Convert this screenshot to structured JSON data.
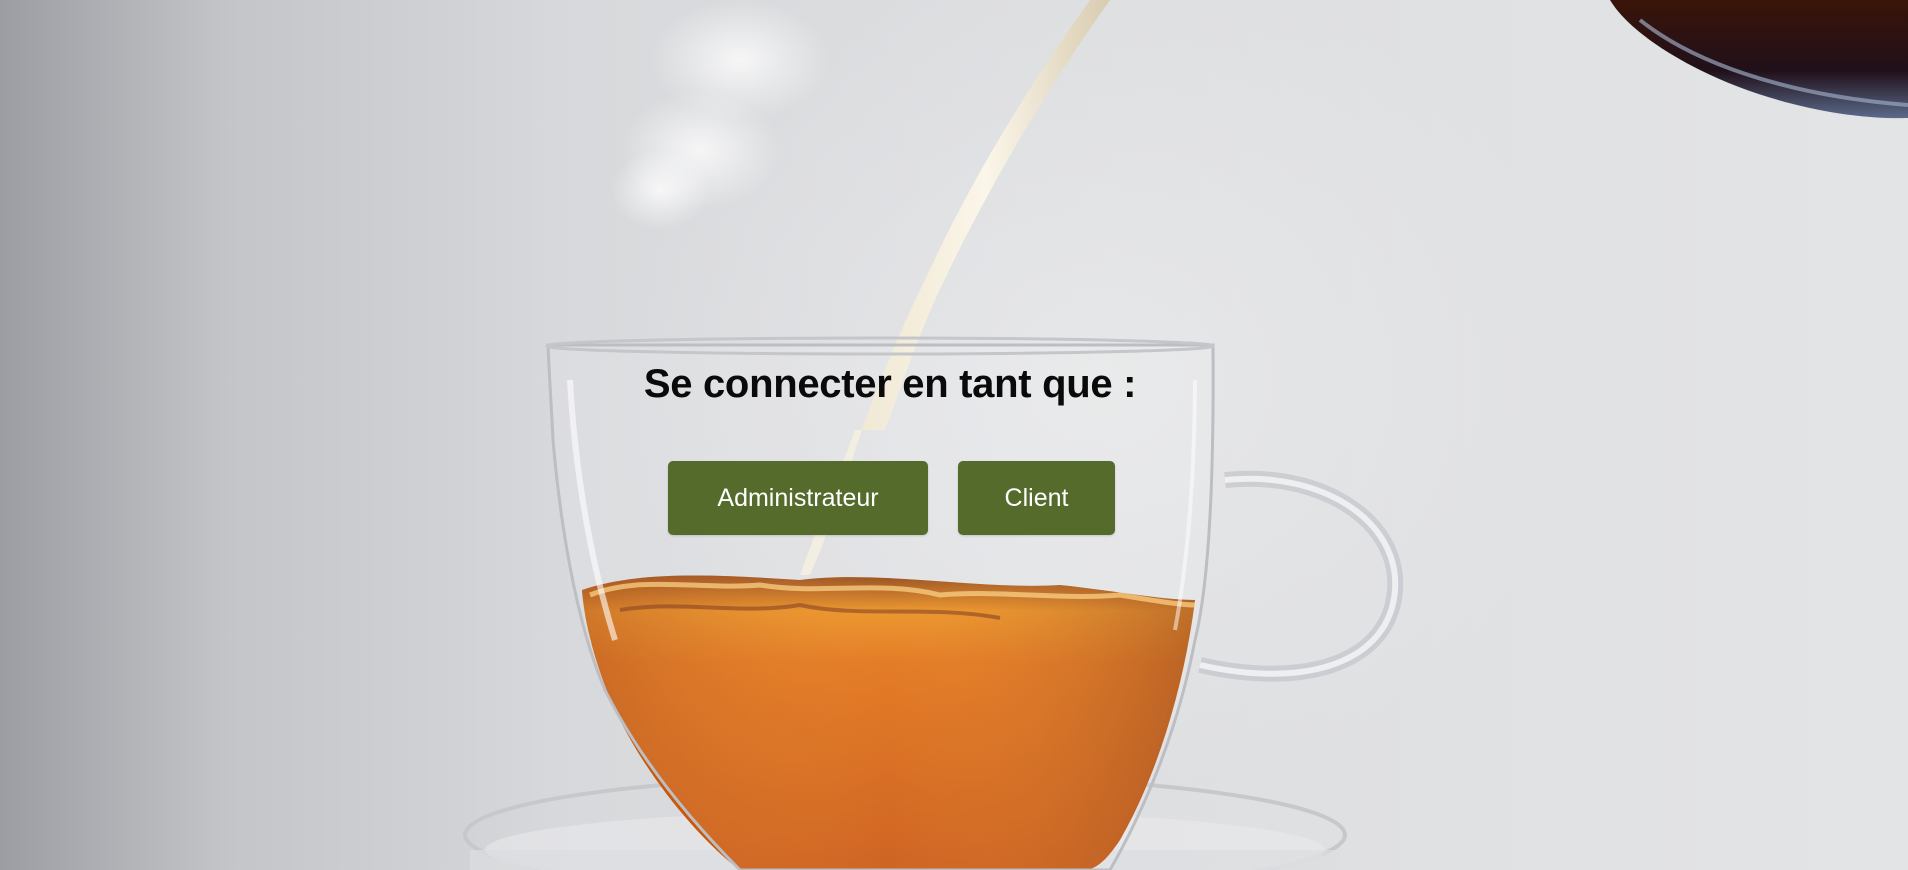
{
  "login": {
    "title": "Se connecter en tant que :",
    "buttons": {
      "admin_label": "Administrateur",
      "client_label": "Client"
    }
  },
  "colors": {
    "button_bg": "#546b2c",
    "button_text": "#ffffff",
    "title_text": "#0a0a0a",
    "tea": "#d9640a"
  },
  "background": {
    "scene": "tea-cup-photo"
  }
}
